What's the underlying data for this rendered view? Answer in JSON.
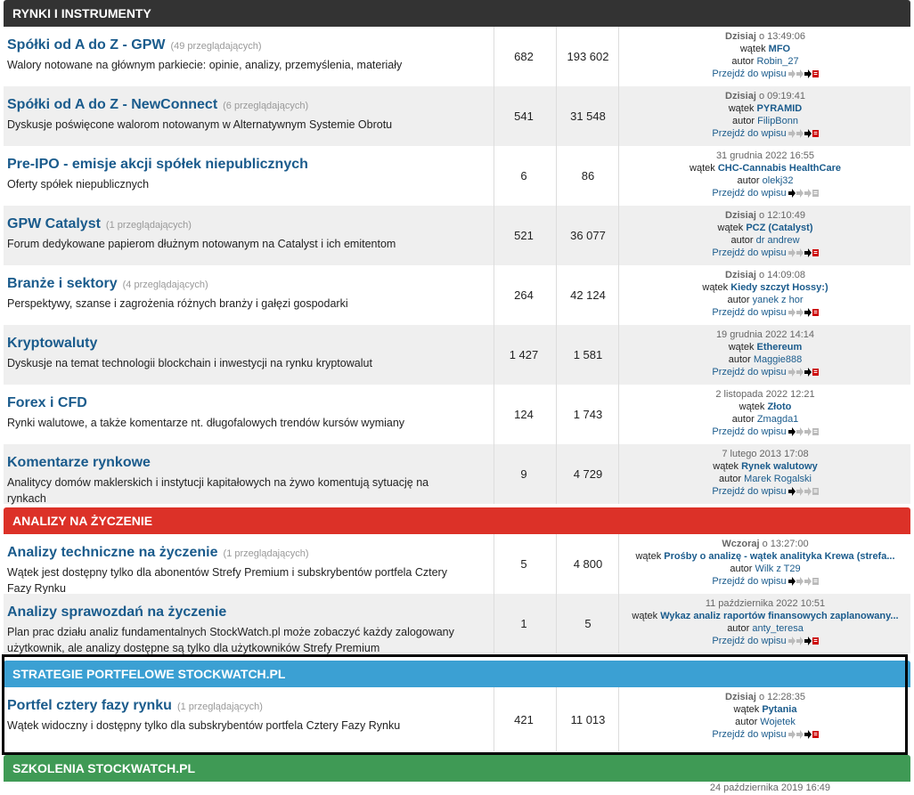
{
  "categories": {
    "rynki": "RYNKI I INSTRUMENTY",
    "analizy": "ANALIZY NA ŻYCZENIE",
    "strategie": "STRATEGIE PORTFELOWE STOCKWATCH.PL",
    "szkolenia": "SZKOLENIA STOCKWATCH.PL"
  },
  "forums": [
    {
      "title": "Spółki od A do Z - GPW",
      "viewers": "(49 przeglądających)",
      "desc": "Walory notowane na głównym parkiecie: opinie, analizy, przemyślenia, materiały",
      "topics": "682",
      "posts": "193 602",
      "date_bold": "Dzisiaj",
      "date_rest": " o 13:49:06",
      "thread_prefix": "wątek",
      "thread": "MFO",
      "author_prefix": "autor",
      "author": "Robin_27",
      "goto": "Przejdź do wpisu"
    },
    {
      "title": "Spółki od A do Z - NewConnect",
      "viewers": "(6 przeglądających)",
      "desc": "Dyskusje poświęcone walorom notowanym w Alternatywnym Systemie Obrotu",
      "topics": "541",
      "posts": "31 548",
      "date_bold": "Dzisiaj",
      "date_rest": " o 09:19:41",
      "thread_prefix": "wątek",
      "thread": "PYRAMID",
      "author_prefix": "autor",
      "author": "FilipBonn",
      "goto": "Przejdź do wpisu"
    },
    {
      "title": "Pre-IPO - emisje akcji spółek niepublicznych",
      "viewers": "",
      "desc": "Oferty spółek niepublicznych",
      "topics": "6",
      "posts": "86",
      "date_bold": "",
      "date_rest": "31 grudnia 2022 16:55",
      "thread_prefix": "wątek",
      "thread": "CHC-Cannabis HealthCare",
      "author_prefix": "autor",
      "author": "olekj32",
      "goto": "Przejdź do wpisu"
    },
    {
      "title": "GPW Catalyst",
      "viewers": "(1 przeglądających)",
      "desc": "Forum dedykowane papierom dłużnym notowanym na Catalyst i ich emitentom",
      "topics": "521",
      "posts": "36 077",
      "date_bold": "Dzisiaj",
      "date_rest": " o 12:10:49",
      "thread_prefix": "wątek",
      "thread": "PCZ (Catalyst)",
      "author_prefix": "autor",
      "author": "dr andrew",
      "goto": "Przejdź do wpisu"
    },
    {
      "title": "Branże i sektory",
      "viewers": "(4 przeglądających)",
      "desc": "Perspektywy, szanse i zagrożenia różnych branży i gałęzi gospodarki",
      "topics": "264",
      "posts": "42 124",
      "date_bold": "Dzisiaj",
      "date_rest": " o 14:09:08",
      "thread_prefix": "wątek",
      "thread": "Kiedy szczyt Hossy:)",
      "author_prefix": "autor",
      "author": "yanek z hor",
      "goto": "Przejdź do wpisu"
    },
    {
      "title": "Kryptowaluty",
      "viewers": "",
      "desc": "Dyskusje na temat technologii blockchain i inwestycji na rynku kryptowalut",
      "topics": "1 427",
      "posts": "1 581",
      "date_bold": "",
      "date_rest": "19 grudnia 2022 14:14",
      "thread_prefix": "wątek",
      "thread": "Ethereum",
      "author_prefix": "autor",
      "author": "Maggie888",
      "goto": "Przejdź do wpisu"
    },
    {
      "title": "Forex i CFD",
      "viewers": "",
      "desc": "Rynki walutowe, a także komentarze nt. długofalowych trendów kursów wymiany",
      "topics": "124",
      "posts": "1 743",
      "date_bold": "",
      "date_rest": "2 listopada 2022 12:21",
      "thread_prefix": "wątek",
      "thread": "Złoto",
      "author_prefix": "autor",
      "author": "Zmagda1",
      "goto": "Przejdź do wpisu"
    },
    {
      "title": "Komentarze rynkowe",
      "viewers": "",
      "desc": "Analitycy domów maklerskich i instytucji kapitałowych na żywo komentują sytuację na rynkach",
      "topics": "9",
      "posts": "4 729",
      "date_bold": "",
      "date_rest": "7 lutego 2013 17:08",
      "thread_prefix": "wątek",
      "thread": "Rynek walutowy",
      "author_prefix": "autor",
      "author": "Marek Rogalski",
      "goto": "Przejdź do wpisu"
    },
    {
      "title": "Analizy techniczne na życzenie",
      "viewers": "(1 przeglądających)",
      "desc": "Wątek jest dostępny tylko dla abonentów Strefy Premium i subskrybentów portfela Cztery Fazy Rynku",
      "topics": "5",
      "posts": "4 800",
      "date_bold": "Wczoraj",
      "date_rest": " o 13:27:00",
      "thread_prefix": "wątek",
      "thread": "Prośby o analizę - wątek analityka Krewa (strefa...",
      "author_prefix": "autor",
      "author": "Wilk z T29",
      "goto": "Przejdź do wpisu"
    },
    {
      "title": "Analizy sprawozdań na życzenie",
      "viewers": "",
      "desc": "Plan prac działu analiz fundamentalnych StockWatch.pl może zobaczyć każdy zalogowany użytkownik, ale analizy dostępne są tylko dla użytkowników Strefy Premium",
      "topics": "1",
      "posts": "5",
      "date_bold": "",
      "date_rest": "11 października 2022 10:51",
      "thread_prefix": "wątek",
      "thread": "Wykaz analiz raportów finansowych zaplanowany...",
      "author_prefix": "autor",
      "author": "anty_teresa",
      "goto": "Przejdź do wpisu"
    },
    {
      "title": "Portfel cztery fazy rynku",
      "viewers": "(1 przeglądających)",
      "desc": "Wątek widoczny i dostępny tylko dla subskrybentów portfela Cztery Fazy Rynku",
      "topics": "421",
      "posts": "11 013",
      "date_bold": "Dzisiaj",
      "date_rest": " o 12:28:35",
      "thread_prefix": "wątek",
      "thread": "Pytania",
      "author_prefix": "autor",
      "author": "Wojetek",
      "goto": "Przejdź do wpisu"
    }
  ],
  "footer_partial_date": "24 października 2019 16:49",
  "colors": {
    "dark": "#333333",
    "red": "#dc3128",
    "blue": "#3ba0d3",
    "green": "#3f9a55",
    "link": "#1a5b8c"
  }
}
